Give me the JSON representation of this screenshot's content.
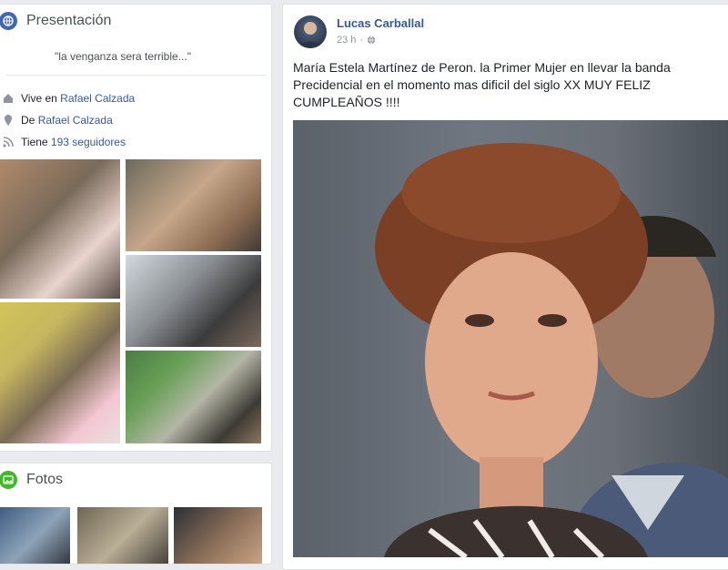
{
  "intro": {
    "title": "Presentación",
    "quote": "\"la venganza sera terrible...\"",
    "lives_prefix": "Vive en",
    "lives_place": "Rafael Calzada",
    "from_prefix": "De",
    "from_place": "Rafael Calzada",
    "followers_prefix": "Tiene",
    "followers_link": "193 seguidores",
    "icon": "globe-icon"
  },
  "photos": {
    "title": "Fotos",
    "icon": "photos-icon"
  },
  "post": {
    "author": "Lucas Carballal",
    "time": "23 h",
    "audience_icon": "globe-icon",
    "text": "María Estela Martínez de Peron. la Primer Mujer en llevar la banda Precidencial en el momento mas dificil del siglo XX MUY FELIZ CUMPLEAÑOS !!!!"
  },
  "colors": {
    "link": "#365899",
    "intro_icon": "#4267b2",
    "photos_icon": "#42b72a"
  }
}
